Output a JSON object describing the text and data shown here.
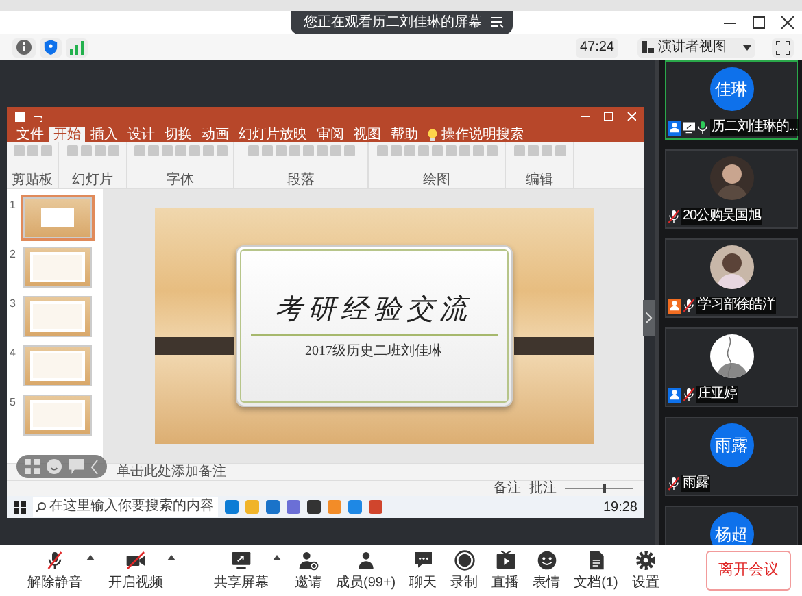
{
  "window": {
    "notice": "您正在观看历二刘佳琳的屏幕"
  },
  "toolbar": {
    "timer": "47:24",
    "view_button": "演讲者视图"
  },
  "shared_screen": {
    "tabs": [
      {
        "label": "文件",
        "selected": false
      },
      {
        "label": "开始",
        "selected": true
      },
      {
        "label": "插入",
        "selected": false
      },
      {
        "label": "设计",
        "selected": false
      },
      {
        "label": "切换",
        "selected": false
      },
      {
        "label": "动画",
        "selected": false
      },
      {
        "label": "幻灯片放映",
        "selected": false
      },
      {
        "label": "审阅",
        "selected": false
      },
      {
        "label": "视图",
        "selected": false
      },
      {
        "label": "帮助",
        "selected": false
      },
      {
        "label": "操作说明搜索",
        "selected": false,
        "kind": "search"
      }
    ],
    "ribbon_groups": [
      "剪贴板",
      "幻灯片",
      "字体",
      "段落",
      "绘图",
      "编辑"
    ],
    "slides": [
      {
        "number": "1",
        "selected": true,
        "kind": "title"
      },
      {
        "number": "2",
        "selected": false,
        "kind": "text"
      },
      {
        "number": "3",
        "selected": false,
        "kind": "text"
      },
      {
        "number": "4",
        "selected": false,
        "kind": "text"
      },
      {
        "number": "5",
        "selected": false,
        "kind": "text"
      }
    ],
    "slide": {
      "title": "考研经验交流",
      "subtitle": "2017级历史二班刘佳琳"
    },
    "notes_placeholder": "单击此处添加备注",
    "status_buttons": [
      "备注",
      "批注"
    ],
    "zoom_slider": {
      "level": 0.55
    },
    "taskbar": {
      "search_placeholder": "在这里输入你要搜索的内容",
      "time": "19:28"
    }
  },
  "participants": [
    {
      "name": "历二刘佳琳的...",
      "avatar": "佳琳",
      "kind": "initials",
      "active": true,
      "muted": false,
      "sharing": true,
      "color": "#0e71eb"
    },
    {
      "name": "20公购吴国旭",
      "kind": "picture",
      "active": false,
      "muted": true,
      "sharing": false
    },
    {
      "name": "学习部徐皓洋",
      "kind": "picture",
      "active": false,
      "muted": true,
      "sharing": false,
      "color": "#f26d21"
    },
    {
      "name": "庄亚婷",
      "kind": "picture",
      "active": false,
      "muted": true,
      "sharing": false,
      "color": "#0e71eb"
    },
    {
      "name": "雨露",
      "avatar": "雨露",
      "kind": "initials",
      "active": false,
      "muted": true,
      "sharing": false
    },
    {
      "avatar": "杨超",
      "kind": "initials",
      "active": false
    }
  ],
  "controls": [
    {
      "kind": "unmute",
      "label": "解除静音",
      "menu": true
    },
    {
      "kind": "video",
      "label": "开启视频",
      "menu": true
    },
    {
      "kind": "share",
      "label": "共享屏幕",
      "menu": true
    },
    {
      "kind": "invite",
      "label": "邀请",
      "menu": false
    },
    {
      "kind": "members",
      "label": "成员(99+)",
      "menu": false
    },
    {
      "kind": "chat",
      "label": "聊天",
      "menu": false
    },
    {
      "kind": "record",
      "label": "录制",
      "menu": false
    },
    {
      "kind": "live",
      "label": "直播",
      "menu": false
    },
    {
      "kind": "reactions",
      "label": "表情",
      "menu": false
    },
    {
      "kind": "documents",
      "label": "文档(1)",
      "menu": false
    },
    {
      "kind": "settings",
      "label": "设置",
      "menu": false
    }
  ],
  "leave_button": "离开会议"
}
